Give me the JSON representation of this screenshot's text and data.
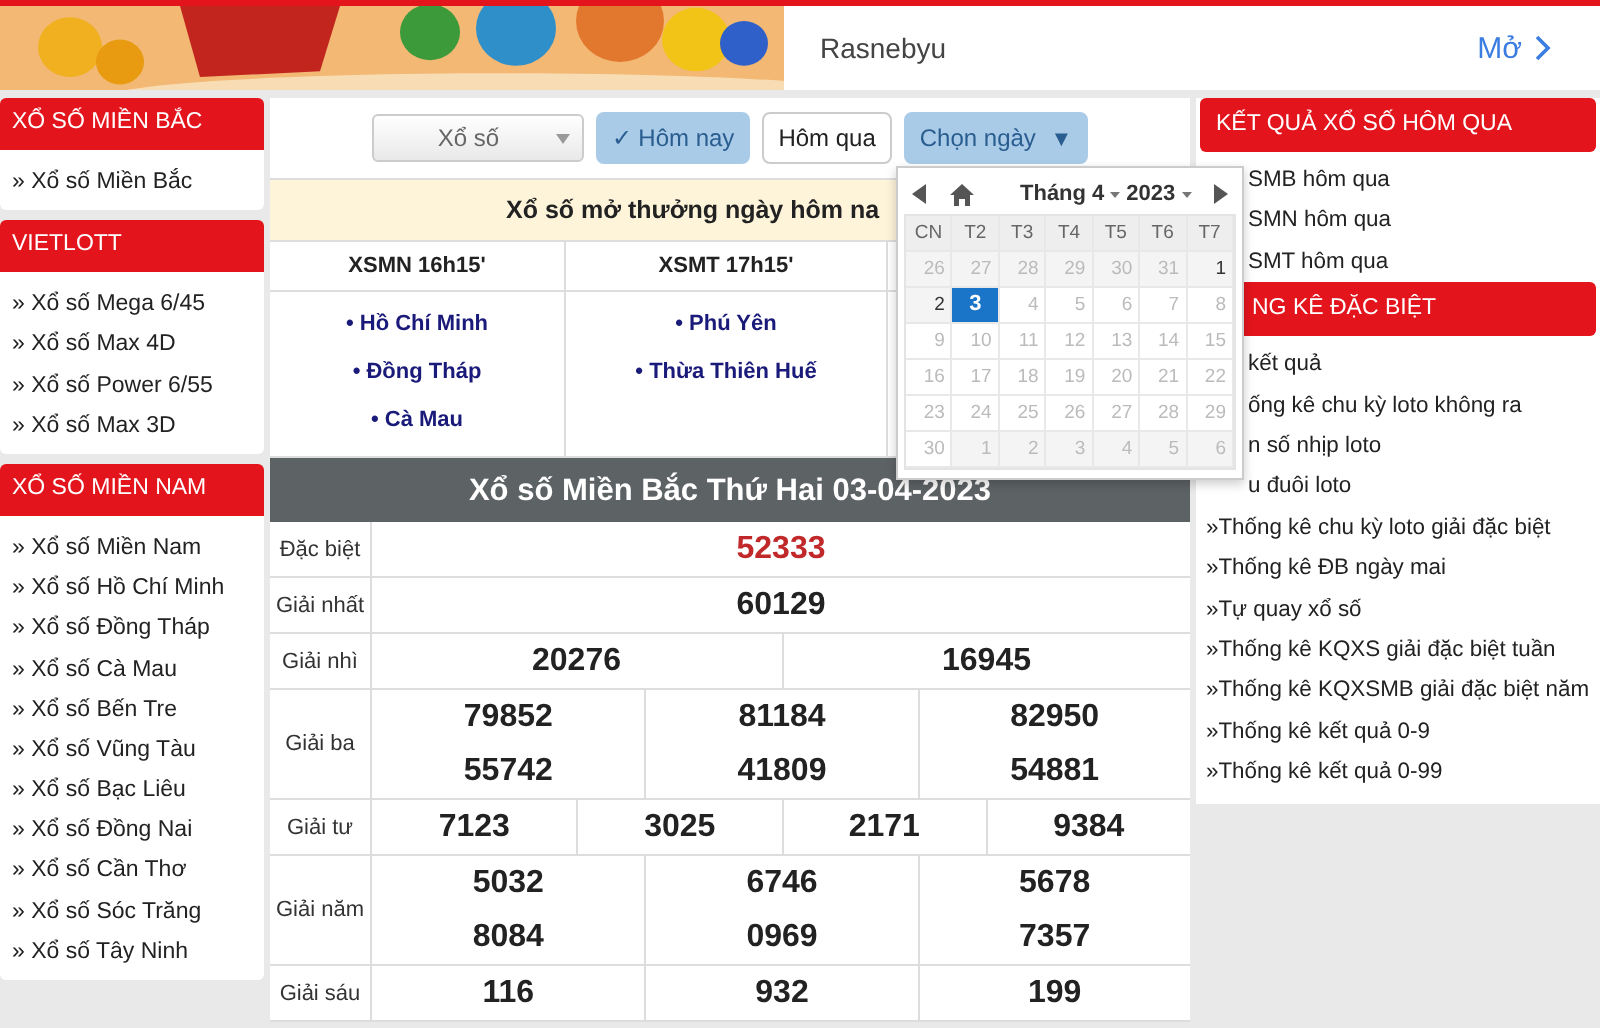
{
  "banner": {
    "ad_text": "Rasnebyu",
    "ad_action": "Mở"
  },
  "left_sidebar": [
    {
      "heading": "XỔ SỐ MIỀN BẮC",
      "items": [
        "» Xổ số Miền Bắc"
      ]
    },
    {
      "heading": "VIETLOTT",
      "items": [
        "» Xổ số Mega 6/45",
        "» Xổ số Max 4D",
        "» Xổ số Power 6/55",
        "» Xổ số Max 3D"
      ]
    },
    {
      "heading": "XỔ SỐ MIỀN NAM",
      "items": [
        "» Xổ số Miền Nam",
        "» Xổ số Hồ Chí Minh",
        "» Xổ số Đồng Tháp",
        "» Xổ số Cà Mau",
        "» Xổ số Bến Tre",
        "» Xổ số Vũng Tàu",
        "» Xổ số Bạc Liêu",
        "» Xổ số Đồng Nai",
        "» Xổ số Cần Thơ",
        "» Xổ số Sóc Trăng",
        "» Xổ số Tây Ninh"
      ]
    }
  ],
  "toolbar": {
    "select": "Xổ số",
    "buttons": [
      {
        "kind": "toggle",
        "label": "✓ Hôm nay",
        "selected": true
      },
      {
        "kind": "toggle",
        "label": "Hôm qua",
        "selected": false
      },
      {
        "kind": "dropdown",
        "label": "Chọn ngày",
        "caret": "▼",
        "expanded": true
      }
    ]
  },
  "announcement": "Xổ số mở thưởng ngày hôm na",
  "schedule": [
    {
      "heading": "XSMN 16h15'",
      "provinces": [
        "• Hồ Chí Minh",
        "• Đồng Tháp",
        "• Cà Mau"
      ]
    },
    {
      "heading": "XSMT 17h15'",
      "provinces": [
        "• Phú Yên",
        "• Thừa Thiên Huế"
      ]
    }
  ],
  "calendar": {
    "month": "Tháng 4",
    "year": "2023",
    "weekdays": [
      "CN",
      "T2",
      "T3",
      "T4",
      "T5",
      "T6",
      "T7"
    ],
    "days": [
      {
        "label": "26",
        "kind": "other",
        "selected": false
      },
      {
        "label": "27",
        "kind": "other",
        "selected": false
      },
      {
        "label": "28",
        "kind": "other",
        "selected": false
      },
      {
        "label": "29",
        "kind": "other",
        "selected": false
      },
      {
        "label": "30",
        "kind": "other",
        "selected": false
      },
      {
        "label": "31",
        "kind": "other",
        "selected": false
      },
      {
        "label": "1",
        "kind": "enabled",
        "selected": false
      },
      {
        "label": "2",
        "kind": "enabled",
        "selected": false
      },
      {
        "label": "3",
        "kind": "enabled",
        "selected": true
      },
      {
        "label": "4",
        "kind": "disabled",
        "selected": false
      },
      {
        "label": "5",
        "kind": "disabled",
        "selected": false
      },
      {
        "label": "6",
        "kind": "disabled",
        "selected": false
      },
      {
        "label": "7",
        "kind": "disabled",
        "selected": false
      },
      {
        "label": "8",
        "kind": "disabled",
        "selected": false
      },
      {
        "label": "9",
        "kind": "disabled",
        "selected": false
      },
      {
        "label": "10",
        "kind": "disabled",
        "selected": false
      },
      {
        "label": "11",
        "kind": "disabled",
        "selected": false
      },
      {
        "label": "12",
        "kind": "disabled",
        "selected": false
      },
      {
        "label": "13",
        "kind": "disabled",
        "selected": false
      },
      {
        "label": "14",
        "kind": "disabled",
        "selected": false
      },
      {
        "label": "15",
        "kind": "disabled",
        "selected": false
      },
      {
        "label": "16",
        "kind": "disabled",
        "selected": false
      },
      {
        "label": "17",
        "kind": "disabled",
        "selected": false
      },
      {
        "label": "18",
        "kind": "disabled",
        "selected": false
      },
      {
        "label": "19",
        "kind": "disabled",
        "selected": false
      },
      {
        "label": "20",
        "kind": "disabled",
        "selected": false
      },
      {
        "label": "21",
        "kind": "disabled",
        "selected": false
      },
      {
        "label": "22",
        "kind": "disabled",
        "selected": false
      },
      {
        "label": "23",
        "kind": "disabled",
        "selected": false
      },
      {
        "label": "24",
        "kind": "disabled",
        "selected": false
      },
      {
        "label": "25",
        "kind": "disabled",
        "selected": false
      },
      {
        "label": "26",
        "kind": "disabled",
        "selected": false
      },
      {
        "label": "27",
        "kind": "disabled",
        "selected": false
      },
      {
        "label": "28",
        "kind": "disabled",
        "selected": false
      },
      {
        "label": "29",
        "kind": "disabled",
        "selected": false
      },
      {
        "label": "30",
        "kind": "disabled",
        "selected": false
      },
      {
        "label": "1",
        "kind": "other",
        "selected": false
      },
      {
        "label": "2",
        "kind": "other",
        "selected": false
      },
      {
        "label": "3",
        "kind": "other",
        "selected": false
      },
      {
        "label": "4",
        "kind": "other",
        "selected": false
      },
      {
        "label": "5",
        "kind": "other",
        "selected": false
      },
      {
        "label": "6",
        "kind": "other",
        "selected": false
      }
    ]
  },
  "results": {
    "title": "Xổ số Miền Bắc Thứ Hai 03-04-2023",
    "prizes": [
      {
        "label": "Đặc biệt",
        "kind": "special",
        "columns": [
          [
            "52333"
          ]
        ]
      },
      {
        "label": "Giải nhất",
        "kind": "normal",
        "columns": [
          [
            "60129"
          ]
        ]
      },
      {
        "label": "Giải nhì",
        "kind": "normal",
        "columns": [
          [
            "20276"
          ],
          [
            "16945"
          ]
        ]
      },
      {
        "label": "Giải ba",
        "kind": "normal",
        "columns": [
          [
            "79852",
            "55742"
          ],
          [
            "81184",
            "41809"
          ],
          [
            "82950",
            "54881"
          ]
        ]
      },
      {
        "label": "Giải tư",
        "kind": "normal",
        "columns": [
          [
            "7123"
          ],
          [
            "3025"
          ],
          [
            "2171"
          ],
          [
            "9384"
          ]
        ]
      },
      {
        "label": "Giải năm",
        "kind": "normal",
        "columns": [
          [
            "5032",
            "8084"
          ],
          [
            "6746",
            "0969"
          ],
          [
            "5678",
            "7357"
          ]
        ]
      },
      {
        "label": "Giải sáu",
        "kind": "normal",
        "columns": [
          [
            "116"
          ],
          [
            "932"
          ],
          [
            "199"
          ]
        ]
      }
    ]
  },
  "right_sidebar": [
    {
      "heading": "KẾT QUẢ XỔ SỐ HÔM QUA",
      "clipped": false,
      "items": [
        {
          "text": "SMB hôm qua",
          "clipped": true
        },
        {
          "text": "SMN hôm qua",
          "clipped": true
        },
        {
          "text": "SMT hôm qua",
          "clipped": true
        }
      ]
    },
    {
      "heading": "NG KÊ ĐẶC BIỆT",
      "clipped": true,
      "items": [
        {
          "text": "kết quả",
          "clipped": true
        },
        {
          "text": "ống kê chu kỳ loto không ra",
          "clipped": true
        },
        {
          "text": "n số nhịp loto",
          "clipped": true
        },
        {
          "text": "u đuôi loto",
          "clipped": true
        },
        {
          "text": "»Thống kê chu kỳ loto giải đặc biệt",
          "clipped": false
        },
        {
          "text": "»Thống kê ĐB ngày mai",
          "clipped": false
        },
        {
          "text": "»Tự quay xổ số",
          "clipped": false
        },
        {
          "text": "»Thống kê KQXS giải đặc biệt tuần",
          "clipped": false
        },
        {
          "text": "»Thống kê KQXSMB giải đặc biệt năm",
          "clipped": false
        },
        {
          "text": "»Thống kê kết quả 0-9",
          "clipped": false
        },
        {
          "text": "»Thống kê kết quả 0-99",
          "clipped": false
        }
      ]
    }
  ]
}
